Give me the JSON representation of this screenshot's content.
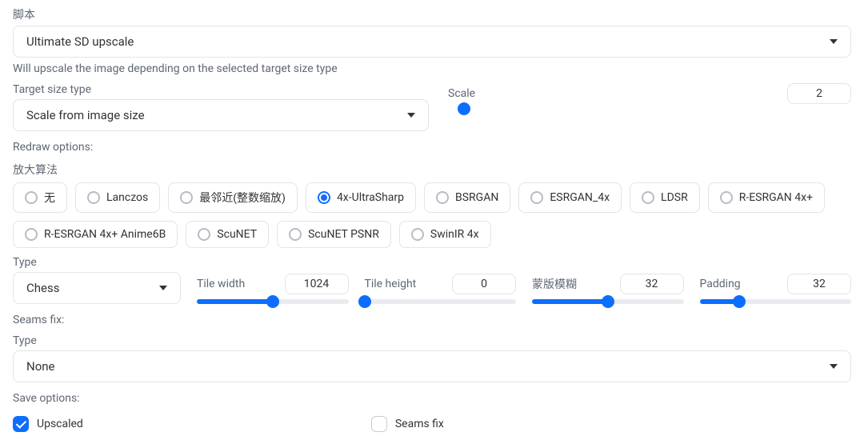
{
  "script": {
    "label": "脚本",
    "value": "Ultimate SD upscale",
    "helper": "Will upscale the image depending on the selected target size type"
  },
  "targetSize": {
    "label": "Target size type",
    "value": "Scale from image size"
  },
  "scale": {
    "label": "Scale",
    "value": "2",
    "fill_pct": 4
  },
  "redrawLabel": "Redraw options:",
  "upscaler": {
    "label": "放大算法",
    "selected": "4x-UltraSharp",
    "options": [
      "无",
      "Lanczos",
      "最邻近(整数缩放)",
      "4x-UltraSharp",
      "BSRGAN",
      "ESRGAN_4x",
      "LDSR",
      "R-ESRGAN 4x+",
      "R-ESRGAN 4x+ Anime6B",
      "ScuNET",
      "ScuNET PSNR",
      "SwinIR 4x"
    ]
  },
  "typeLabel": "Type",
  "typeValue": "Chess",
  "tileWidth": {
    "label": "Tile width",
    "value": "1024",
    "fill_pct": 50
  },
  "tileHeight": {
    "label": "Tile height",
    "value": "0",
    "fill_pct": 0
  },
  "maskBlur": {
    "label": "蒙版模糊",
    "value": "32",
    "fill_pct": 50
  },
  "padding": {
    "label": "Padding",
    "value": "32",
    "fill_pct": 26
  },
  "seamsFixLabel": "Seams fix:",
  "seamsType": {
    "label": "Type",
    "value": "None"
  },
  "saveLabel": "Save options:",
  "upscaledCheck": {
    "label": "Upscaled",
    "checked": true
  },
  "seamsFixCheck": {
    "label": "Seams fix",
    "checked": false
  }
}
